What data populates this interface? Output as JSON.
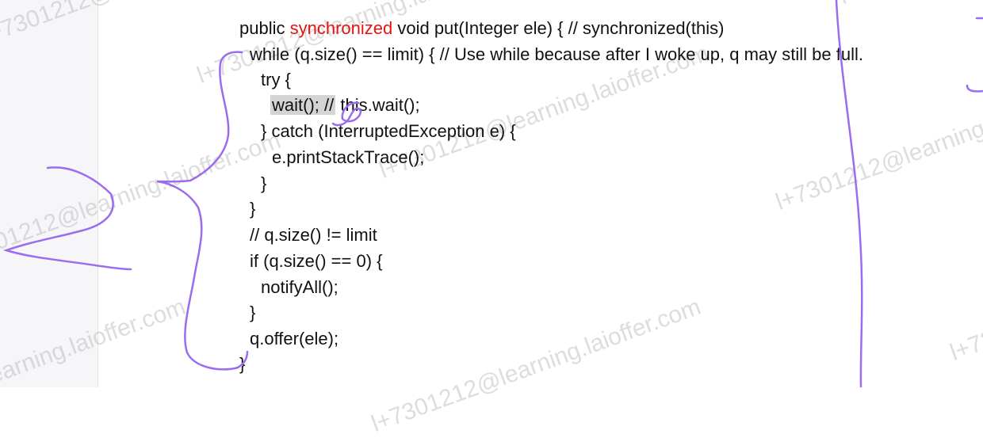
{
  "watermark": "l+7301212@learning.laioffer.com",
  "code": {
    "line0_a": "public ",
    "line0_kw": "synchronized",
    "line0_b": " void put(Integer ele) { // synchronized(this)",
    "line1": "while (q.size() == limit) { // Use while because after I woke up, q may still be full.",
    "line2": "try {",
    "line3_hl": "wait(); //",
    "line3_rest": " this.wait();",
    "line4": "} catch (InterruptedException e) {",
    "line5": "e.printStackTrace();",
    "line6": "}",
    "line7": "}",
    "line8": "// q.size() != limit",
    "line9": "if (q.size() == 0) {",
    "line10": "notifyAll();",
    "line11": "}",
    "line12": "q.offer(ele);",
    "line13": "}"
  },
  "colors": {
    "keyword": "#e31414",
    "ink": "#9b6cf0",
    "highlight": "#d4d4d4"
  }
}
